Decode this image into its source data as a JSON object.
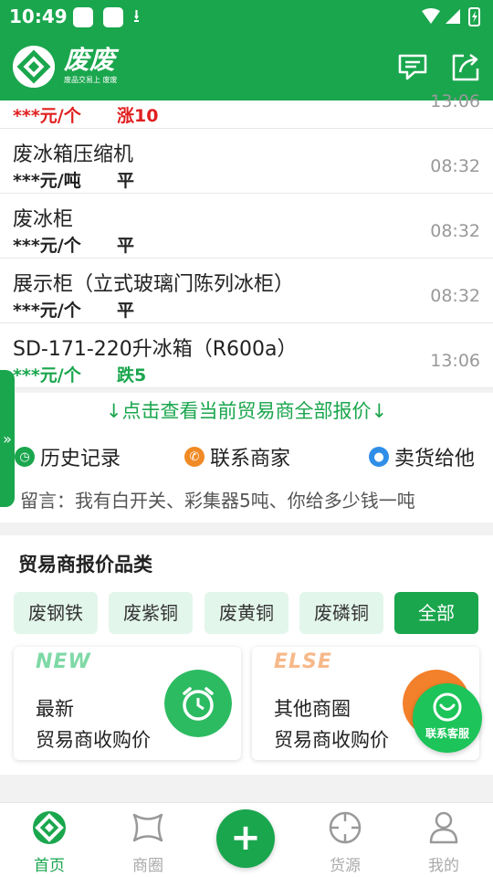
{
  "status_bar": {
    "time": "10:49"
  },
  "header": {
    "brand_name": "废废",
    "slogan": "废品交易上 废废",
    "icons": [
      "message-icon",
      "share-icon"
    ]
  },
  "price_rows": [
    {
      "title": "",
      "price": "***元/个",
      "change": "涨10",
      "time": "13:06",
      "trend": "up"
    },
    {
      "title": "废冰箱压缩机",
      "price": "***元/吨",
      "change": "平",
      "time": "08:32",
      "trend": "flat"
    },
    {
      "title": "废冰柜",
      "price": "***元/个",
      "change": "平",
      "time": "08:32",
      "trend": "flat"
    },
    {
      "title": "展示柜（立式玻璃门陈列冰柜）",
      "price": "***元/个",
      "change": "平",
      "time": "08:32",
      "trend": "flat"
    },
    {
      "title": "SD-171-220升冰箱（R600a）",
      "price": "***元/个",
      "change": "跌5",
      "time": "13:06",
      "trend": "down"
    }
  ],
  "view_all": "↓点击查看当前贸易商全部报价↓",
  "actions": {
    "history": "历史记录",
    "contact": "联系商家",
    "sell": "卖货给他"
  },
  "message": "留言：我有白开关、彩集器5吨、你给多少钱一吨",
  "side_tab": "»",
  "categories": {
    "title": "贸易商报价品类",
    "chips": [
      "废钢铁",
      "废紫铜",
      "废黄铜",
      "废磷铜",
      "全部"
    ],
    "active": "全部"
  },
  "cards": [
    {
      "tag": "NEW",
      "line1": "最新",
      "line2": "贸易商收购价",
      "tag_color": "#7fd9a6",
      "circle_color": "#2dbb62"
    },
    {
      "tag": "ELSE",
      "line1": "其他商圈",
      "line2": "贸易商收购价",
      "tag_color": "#f7b98a",
      "circle_color": "#f3802a"
    }
  ],
  "service_button": "联系客服",
  "nav": {
    "items": [
      "首页",
      "商圈",
      "货源",
      "我的"
    ],
    "active": "首页",
    "plus": "+"
  },
  "colors": {
    "brand": "#1aa64d",
    "up": "#e02020",
    "down": "#1aa64d"
  }
}
